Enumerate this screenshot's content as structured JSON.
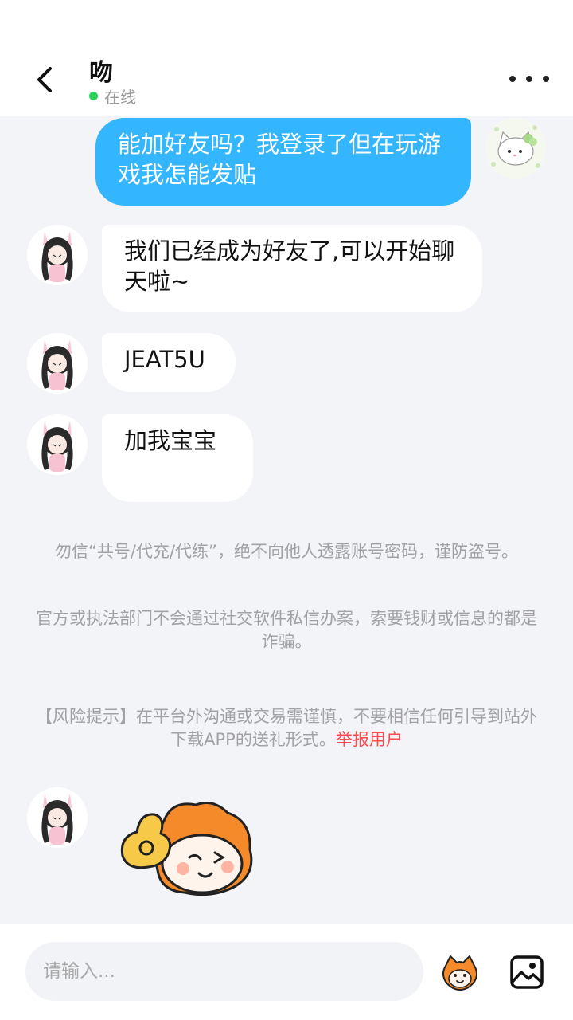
{
  "header": {
    "title": "吻",
    "status": "在线",
    "back_icon": "back-arrow-icon",
    "more_icon": "more-dots-icon"
  },
  "messages": [
    {
      "direction": "outgoing",
      "type": "text",
      "text": "能加好友吗？我登录了但在玩游戏我怎能发贴"
    },
    {
      "direction": "incoming",
      "type": "text",
      "text": "我们已经成为好友了,可以开始聊天啦~"
    },
    {
      "direction": "incoming",
      "type": "text",
      "text": "JEAT5U"
    },
    {
      "direction": "incoming",
      "type": "text",
      "text": "加我宝宝"
    },
    {
      "direction": "incoming",
      "type": "sticker",
      "sticker": "fox-wink-ok-sticker"
    }
  ],
  "notices": {
    "warning1": "勿信“共号/代充/代练”，绝不向他人透露账号密码，谨防盗号。",
    "warning2": "官方或执法部门不会通过社交软件私信办案，索要钱财或信息的都是诈骗。",
    "risk": "【风险提示】在平台外沟通或交易需谨慎，不要相信任何引导到站外下载APP的送礼形式。",
    "report_link": "举报用户"
  },
  "input": {
    "placeholder": "请输入...",
    "value": ""
  },
  "icons": {
    "emoji": "fox-emoji-icon",
    "image": "image-picker-icon"
  },
  "colors": {
    "outgoing_bubble": "#34b6ff",
    "incoming_bubble": "#ffffff",
    "background": "#f3f4f8",
    "online_dot": "#2bd15a",
    "report_link": "#ff4a4a"
  }
}
